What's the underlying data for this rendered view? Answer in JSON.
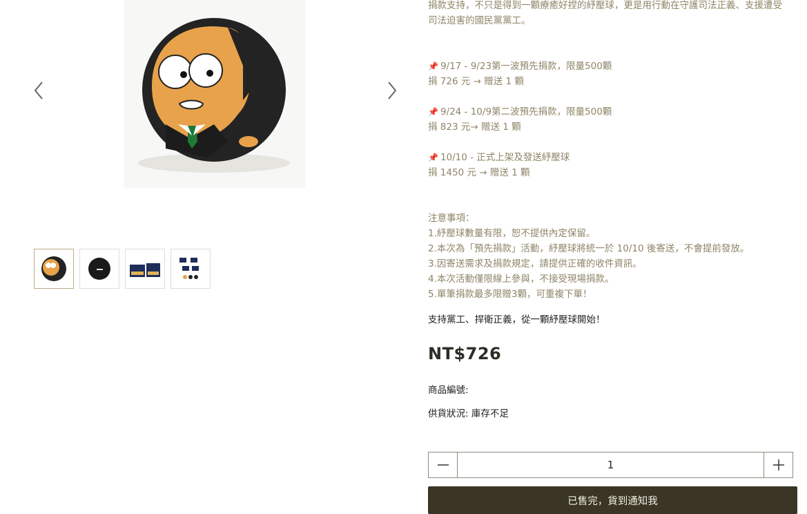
{
  "gallery": {
    "prev_icon": "chevron-left-icon",
    "next_icon": "chevron-right-icon",
    "thumbnails": [
      {
        "name": "thumb-face-ball",
        "active": true
      },
      {
        "name": "thumb-black-ball",
        "active": false
      },
      {
        "name": "thumb-boxes",
        "active": false
      },
      {
        "name": "thumb-set",
        "active": false
      }
    ]
  },
  "description": {
    "intro_line1": "捐款支持，不只是得到一顆療癒好捏的紓壓球，更是用行動在守護司法正義、支援遭受",
    "intro_line2": "司法迫害的國民黨黨工。",
    "wave1_title": "9/17 - 9/23第一波預先捐款，限量500顆",
    "wave1_detail": "捐 726 元 → 贈送 1 顆",
    "wave2_title": "9/24 - 10/9第二波預先捐款，限量500顆",
    "wave2_detail": "捐 823 元→ 贈送 1 顆",
    "wave3_title": "10/10 - 正式上架及發送紓壓球",
    "wave3_detail": "捐 1450 元 → 贈送 1 顆",
    "notes_title": "注意事項：",
    "notes": [
      "1.紓壓球數量有限，恕不提供內定保留。",
      "2.本次為「預先捐款」活動，紓壓球將統一於 10/10 後寄送，不會提前發放。",
      "3.因寄送需求及捐款規定，請提供正確的收件資訊。",
      "4.本次活動僅限線上參與，不接受現場捐款。",
      "5.單筆捐款最多限贈3顆，可重複下單！"
    ],
    "pin_icon": "📌"
  },
  "slogan": "支持黨工、捍衛正義，從一顆紓壓球開始！",
  "price": "NT$726",
  "sku_label": "商品編號:",
  "stock_label": "供貨狀況: 庫存不足",
  "quantity": {
    "minus_icon": "minus-icon",
    "plus_icon": "plus-icon",
    "value": "1"
  },
  "soldout_button": "已售完，貨到通知我",
  "colors": {
    "accent_dark": "#3a3525",
    "desc_text": "#8e8467",
    "pin": "#e0306a"
  }
}
